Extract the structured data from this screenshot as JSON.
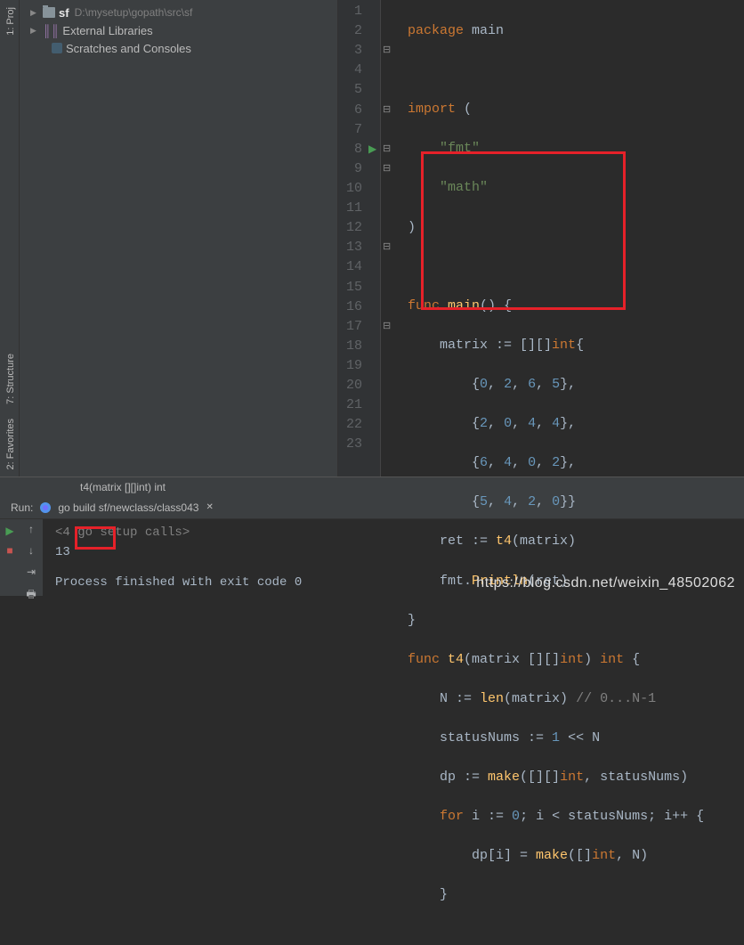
{
  "leftTabs": {
    "proj": "1: Proj",
    "structure": "7: Structure",
    "favorites": "2: Favorites"
  },
  "tree": {
    "sf": "sf",
    "sfPath": "D:\\mysetup\\gopath\\src\\sf",
    "ext": "External Libraries",
    "scratch": "Scratches and Consoles"
  },
  "code": {
    "l1": {
      "pkg": "package",
      "main": "main"
    },
    "l3": {
      "imp": "import",
      "op": " ("
    },
    "l4": "\"fmt\"",
    "l5": "\"math\"",
    "l6": ")",
    "l8": {
      "fn": "func",
      "nm": "main",
      "rest": "() {"
    },
    "l9": {
      "a": "matrix := [][]",
      "t": "int",
      "b": "{"
    },
    "l10": {
      "a": "{",
      "n1": "0",
      "n2": "2",
      "n3": "6",
      "n4": "5",
      "b": "},"
    },
    "l11": {
      "a": "{",
      "n1": "2",
      "n2": "0",
      "n3": "4",
      "n4": "4",
      "b": "},"
    },
    "l12": {
      "a": "{",
      "n1": "6",
      "n2": "4",
      "n3": "0",
      "n4": "2",
      "b": "},"
    },
    "l13": {
      "a": "{",
      "n1": "5",
      "n2": "4",
      "n3": "2",
      "n4": "0",
      "b": "}}"
    },
    "l14": {
      "a": "ret := ",
      "f": "t4",
      "b": "(matrix)"
    },
    "l15": {
      "a": "fmt.",
      "f": "Println",
      "b": "(ret)"
    },
    "l16": "}",
    "l17": {
      "fn": "func",
      "nm": "t4",
      "a": "(matrix [][]",
      "t1": "int",
      "b": ") ",
      "t2": "int",
      "c": " {"
    },
    "l18": {
      "a": "N := ",
      "f": "len",
      "b": "(matrix) ",
      "c": "// 0...N-1"
    },
    "l19": {
      "a": "statusNums := ",
      "n": "1",
      "b": " << N"
    },
    "l20": {
      "a": "dp := ",
      "f": "make",
      "b": "([][]",
      "t": "int",
      "c": ", statusNums)"
    },
    "l21": {
      "fr": "for",
      "a": " i := ",
      "n1": "0",
      "b": "; i < statusNums; i++ {"
    },
    "l22": {
      "a": "dp[i] = ",
      "f": "make",
      "b": "([]",
      "t": "int",
      "c": ", N)"
    },
    "l23": "}"
  },
  "breadcrumb": "t4(matrix [][]int) int",
  "run": {
    "label": "Run:",
    "title": "go build sf/newclass/class043",
    "setup": "<4 go setup calls>",
    "out": "13",
    "finished": "Process finished with exit code 0"
  },
  "watermark": "https://blog.csdn.net/weixin_48502062"
}
